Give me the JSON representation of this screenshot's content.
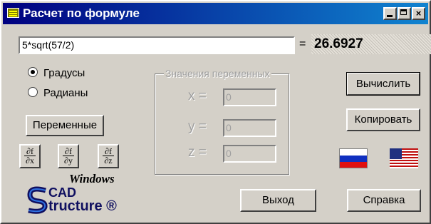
{
  "window": {
    "title": "Расчет по формуле",
    "controls": {
      "minimize": "_",
      "maximize": "□",
      "close": "×"
    }
  },
  "formula": {
    "expression": "5*sqrt(57/2)",
    "equals": "=",
    "result": "26.6927"
  },
  "angle_mode": {
    "options": [
      {
        "label": "Градусы",
        "selected": true
      },
      {
        "label": "Радианы",
        "selected": false
      }
    ]
  },
  "buttons": {
    "variables": "Переменные",
    "calculate": "Вычислить",
    "copy": "Копировать",
    "exit": "Выход",
    "help": "Справка"
  },
  "variables_group": {
    "legend": "Значения переменных",
    "vars": [
      {
        "label": "x =",
        "value": "0"
      },
      {
        "label": "y =",
        "value": "0"
      },
      {
        "label": "z =",
        "value": "0"
      }
    ]
  },
  "derivatives": [
    {
      "num": "∂f",
      "den": "∂x"
    },
    {
      "num": "∂f",
      "den": "∂y"
    },
    {
      "num": "∂f",
      "den": "∂z"
    }
  ],
  "logo": {
    "windows": "Windows",
    "cad": "CAD",
    "structure": "tructure ®"
  },
  "icons": {
    "app": "calculator-icon",
    "flag_ru": "russian-flag-icon",
    "flag_us": "us-flag-icon"
  },
  "colors": {
    "titlebar": "#000080",
    "face": "#d4d0c8"
  }
}
